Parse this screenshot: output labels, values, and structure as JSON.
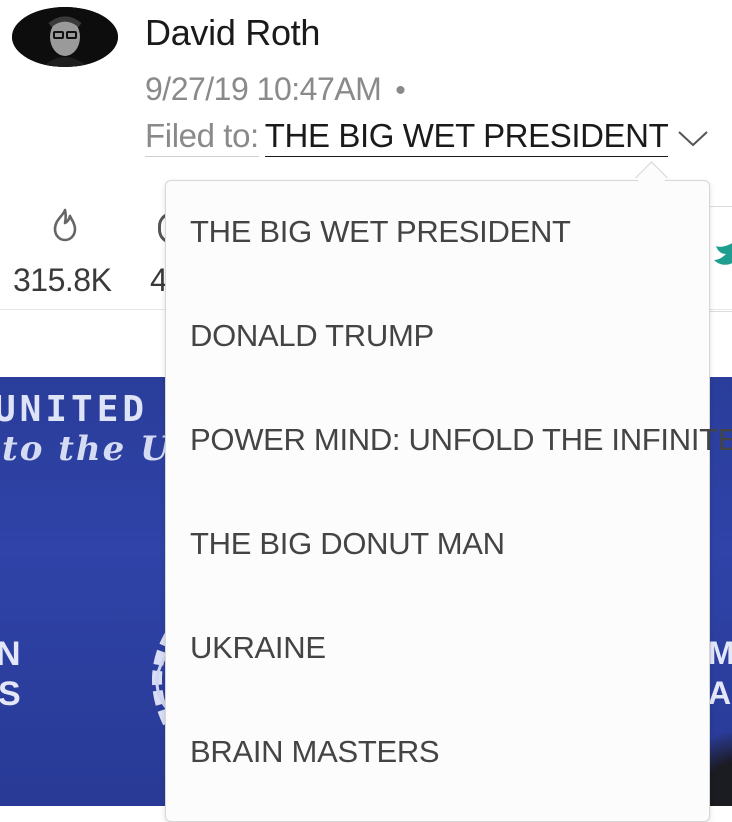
{
  "author": {
    "name": "David Roth"
  },
  "post": {
    "datetime": "9/27/19 10:47AM",
    "separator": "•",
    "filed_label": "Filed to:",
    "filed_value": "THE BIG WET PRESIDENT"
  },
  "stats": {
    "views": "315.8K",
    "comments_partial": "4"
  },
  "photo": {
    "banner_line1": "UNITED S",
    "banner_line2": "to the UN",
    "left_letters": [
      "N",
      "S"
    ],
    "right_letters": [
      "M",
      "A"
    ]
  },
  "dropdown": {
    "items": [
      "THE BIG WET PRESIDENT",
      "DONALD TRUMP",
      "POWER MIND: UNFOLD THE INFINITE",
      "THE BIG DONUT MAN",
      "UKRAINE",
      "BRAIN MASTERS"
    ]
  },
  "colors": {
    "twitter": "#1da1a0",
    "photo_blue": "#2f43a8",
    "muted_text": "#8a8a8a"
  },
  "icons": [
    "flame-icon",
    "comment-icon",
    "chevron-down-icon",
    "twitter-icon"
  ]
}
